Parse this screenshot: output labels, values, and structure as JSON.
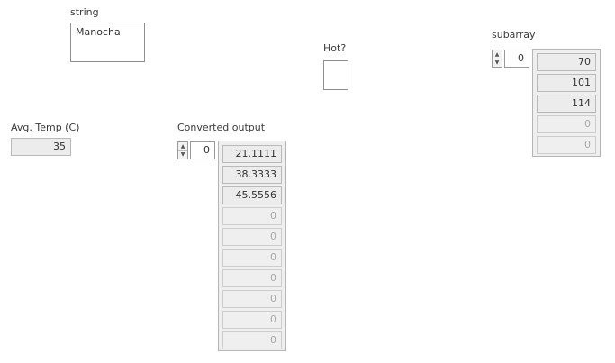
{
  "string_control": {
    "label": "string",
    "value": "Manocha"
  },
  "hot_indicator": {
    "label": "Hot?"
  },
  "avg_temp": {
    "label": "Avg. Temp (C)",
    "value": "35"
  },
  "converted_output": {
    "label": "Converted output",
    "index": "0",
    "cells": [
      {
        "value": "21.1111",
        "empty": false
      },
      {
        "value": "38.3333",
        "empty": false
      },
      {
        "value": "45.5556",
        "empty": false
      },
      {
        "value": "0",
        "empty": true
      },
      {
        "value": "0",
        "empty": true
      },
      {
        "value": "0",
        "empty": true
      },
      {
        "value": "0",
        "empty": true
      },
      {
        "value": "0",
        "empty": true
      },
      {
        "value": "0",
        "empty": true
      },
      {
        "value": "0",
        "empty": true
      }
    ]
  },
  "subarray": {
    "label": "subarray",
    "index": "0",
    "cells": [
      {
        "value": "70",
        "empty": false
      },
      {
        "value": "101",
        "empty": false
      },
      {
        "value": "114",
        "empty": false
      },
      {
        "value": "0",
        "empty": true
      },
      {
        "value": "0",
        "empty": true
      }
    ]
  },
  "icons": {
    "spin_up": "▲",
    "spin_down": "▼"
  }
}
